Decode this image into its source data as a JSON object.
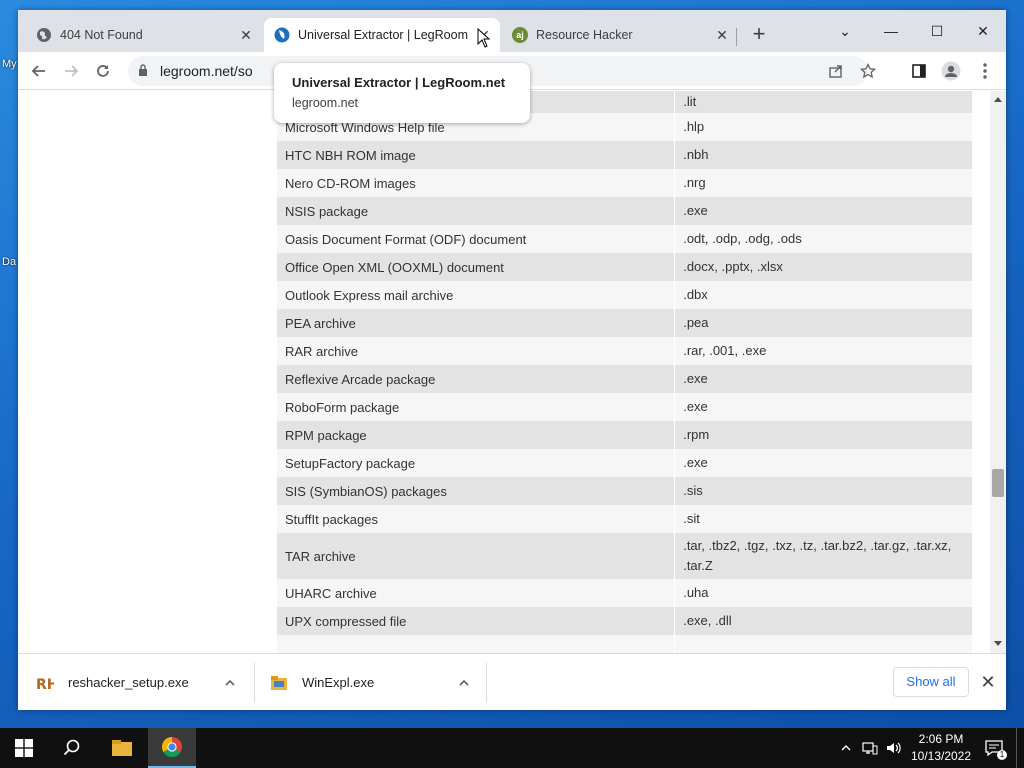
{
  "desktop": {
    "label_1": "My",
    "label_2": "Da"
  },
  "tabs": [
    {
      "title": "404 Not Found",
      "favicon": "globe-icon"
    },
    {
      "title": "Universal Extractor | LegRoom.net",
      "favicon": "legroom-icon"
    },
    {
      "title": "Resource Hacker",
      "favicon": "resource-hacker-icon"
    }
  ],
  "window_controls": {
    "tab_search": "⌄",
    "minimize": "—",
    "maximize": "☐",
    "close": "✕"
  },
  "toolbar": {
    "url": "legroom.net/so"
  },
  "hover_card": {
    "title": "Universal Extractor | LegRoom.net",
    "domain": "legroom.net"
  },
  "table": {
    "rows": [
      {
        "name": "",
        "ext": ".lit"
      },
      {
        "name": "Microsoft Windows Help file",
        "ext": ".hlp"
      },
      {
        "name": "HTC NBH ROM image",
        "ext": ".nbh"
      },
      {
        "name": "Nero CD-ROM images",
        "ext": ".nrg"
      },
      {
        "name": "NSIS package",
        "ext": ".exe"
      },
      {
        "name": "Oasis Document Format (ODF) document",
        "ext": ".odt, .odp, .odg, .ods"
      },
      {
        "name": "Office Open XML (OOXML) document",
        "ext": ".docx, .pptx, .xlsx"
      },
      {
        "name": "Outlook Express mail archive",
        "ext": ".dbx"
      },
      {
        "name": "PEA archive",
        "ext": ".pea"
      },
      {
        "name": "RAR archive",
        "ext": ".rar, .001, .exe"
      },
      {
        "name": "Reflexive Arcade package",
        "ext": ".exe"
      },
      {
        "name": "RoboForm package",
        "ext": ".exe"
      },
      {
        "name": "RPM package",
        "ext": ".rpm"
      },
      {
        "name": "SetupFactory package",
        "ext": ".exe"
      },
      {
        "name": "SIS (SymbianOS) packages",
        "ext": ".sis"
      },
      {
        "name": "StuffIt packages",
        "ext": ".sit"
      },
      {
        "name": "TAR archive",
        "ext": ".tar, .tbz2, .tgz, .txz, .tz, .tar.bz2, .tar.gz, .tar.xz, .tar.Z"
      },
      {
        "name": "UHARC archive",
        "ext": ".uha"
      },
      {
        "name": "UPX compressed file",
        "ext": ".exe, .dll"
      },
      {
        "name": "",
        "ext": ""
      }
    ]
  },
  "downloads": {
    "items": [
      {
        "filename": "reshacker_setup.exe",
        "icon": "reshacker-icon"
      },
      {
        "filename": "WinExpl.exe",
        "icon": "winexpl-icon"
      }
    ],
    "show_all": "Show all"
  },
  "taskbar": {
    "time": "2:06 PM",
    "date": "10/13/2022"
  }
}
